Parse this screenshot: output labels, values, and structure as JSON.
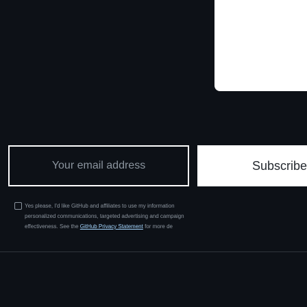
{
  "newsletter": {
    "email_placeholder": "Your email address",
    "subscribe_label": "Subscribe",
    "consent_line1": "Yes please, I'd like GitHub and affiliates to use my information",
    "consent_line2": "personalized communications, targeted advertising and campaign",
    "consent_line3_prefix": "effectiveness. See the ",
    "privacy_link": "GitHub Privacy Statement",
    "consent_line3_suffix": " for more de"
  }
}
